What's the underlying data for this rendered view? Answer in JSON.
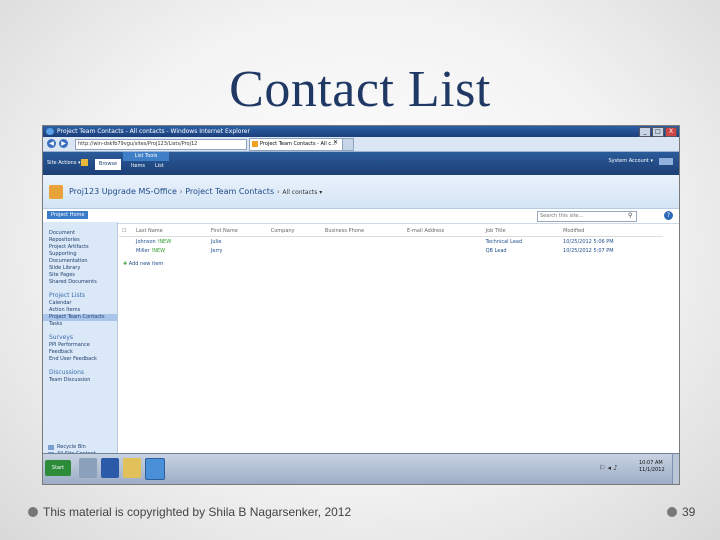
{
  "slide": {
    "title": "Contact List",
    "footer": "This material is copyrighted by Shila B Nagarsenker, 2012",
    "page_number": "39"
  },
  "browser": {
    "window_title": "Project Team Contacts - All contacts - Windows Internet Explorer",
    "address": "http://win-dskfb79vgu/sites/Proj123/Lists/Proj12",
    "tab_label": "Project Team Contacts - All c...",
    "buttons": {
      "minimize": "_",
      "maximize": "□",
      "close": "X"
    }
  },
  "ribbon": {
    "site_actions": "Site Actions ▾",
    "browse_tab": "Browse",
    "list_tools": "List Tools",
    "items_tab": "Items",
    "list_tab": "List",
    "account": "System Account ▾"
  },
  "banner": {
    "site": "Proj123 Upgrade MS-Office",
    "sep1": "›",
    "list": "Project Team Contacts",
    "sep2": "›",
    "view": "All contacts ▾"
  },
  "topnav": {
    "home": "Project Home",
    "search_placeholder": "Search this site...",
    "help": "?"
  },
  "quicklaunch": {
    "group1": [
      "Document",
      "Repositories",
      "Project Artifacts",
      "Supporting",
      "Documentation",
      "Slide Library",
      "Site Pages",
      "Shared Documents"
    ],
    "group2_head": "Project Lists",
    "group2": [
      "Calendar",
      "Action Items",
      "Project Team Contacts",
      "Tasks"
    ],
    "group3_head": "Surveys",
    "group3": [
      "PPI Performance",
      "Feedback",
      "End User Feedback"
    ],
    "group4_head": "Discussions",
    "group4": [
      "Team Discussion"
    ],
    "recycle_bin": "Recycle Bin",
    "all_site_content": "All Site Content"
  },
  "list": {
    "headers": [
      "Last Name",
      "First Name",
      "Company",
      "Business Phone",
      "E-mail Address",
      "Job Title",
      "Modified"
    ],
    "rows": [
      {
        "last": "Johnson",
        "new": "!NEW",
        "first": "Julie",
        "company": "",
        "phone": "",
        "email": "",
        "title": "Technical Lead",
        "modified": "10/25/2012 5:06 PM"
      },
      {
        "last": "Miller",
        "new": "!NEW",
        "first": "Jerry",
        "company": "",
        "phone": "",
        "email": "",
        "title": "QB Lead",
        "modified": "10/25/2012 5:07 PM"
      }
    ],
    "add_new": "Add new item"
  },
  "taskbar": {
    "start": "Start",
    "tray": "⚐ ◂ ♪",
    "time": "10:07 AM",
    "date": "11/1/2012"
  }
}
